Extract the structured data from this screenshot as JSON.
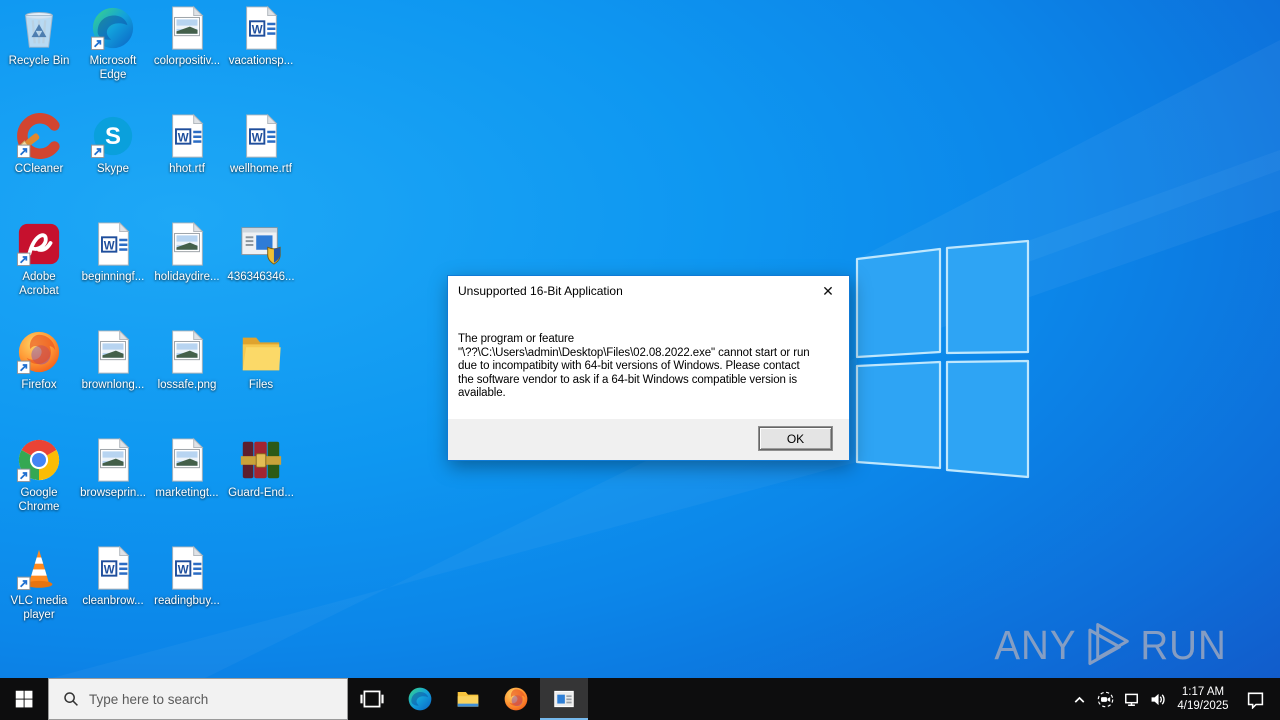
{
  "desktop": {
    "icons": [
      {
        "label": "Recycle Bin",
        "icon": "recycle-bin",
        "shortcut": false
      },
      {
        "label": "Microsoft Edge",
        "icon": "edge",
        "shortcut": true
      },
      {
        "label": "colorpositiv...",
        "icon": "image-file",
        "shortcut": false
      },
      {
        "label": "vacationsp...",
        "icon": "word-file",
        "shortcut": false
      },
      {
        "label": "CCleaner",
        "icon": "ccleaner",
        "shortcut": true
      },
      {
        "label": "Skype",
        "icon": "skype",
        "shortcut": true
      },
      {
        "label": "hhot.rtf",
        "icon": "word-file",
        "shortcut": false
      },
      {
        "label": "wellhome.rtf",
        "icon": "word-file",
        "shortcut": false
      },
      {
        "label": "Adobe Acrobat",
        "icon": "acrobat",
        "shortcut": true
      },
      {
        "label": "beginningf...",
        "icon": "word-file",
        "shortcut": false
      },
      {
        "label": "holidaydire...",
        "icon": "image-file",
        "shortcut": false
      },
      {
        "label": "436346346...",
        "icon": "installer",
        "shortcut": false
      },
      {
        "label": "Firefox",
        "icon": "firefox",
        "shortcut": true
      },
      {
        "label": "brownlong...",
        "icon": "image-file",
        "shortcut": false
      },
      {
        "label": "lossafe.png",
        "icon": "image-file",
        "shortcut": false
      },
      {
        "label": "Files",
        "icon": "folder",
        "shortcut": false
      },
      {
        "label": "Google Chrome",
        "icon": "chrome",
        "shortcut": true
      },
      {
        "label": "browseprin...",
        "icon": "image-file",
        "shortcut": false
      },
      {
        "label": "marketingt...",
        "icon": "image-file",
        "shortcut": false
      },
      {
        "label": "Guard-End...",
        "icon": "winrar",
        "shortcut": false
      },
      {
        "label": "VLC media player",
        "icon": "vlc",
        "shortcut": true
      },
      {
        "label": "cleanbrow...",
        "icon": "word-file",
        "shortcut": false
      },
      {
        "label": "readingbuy...",
        "icon": "word-file",
        "shortcut": false
      }
    ],
    "watermark": {
      "any": "ANY",
      "run": "RUN",
      "logo_icon": "anyrun-play-icon"
    }
  },
  "dialog": {
    "title": "Unsupported 16-Bit Application",
    "close_glyph": "✕",
    "body": "The program or feature\n\"\\??\\C:\\Users\\admin\\Desktop\\Files\\02.08.2022.exe\" cannot start or run\ndue to incompatibity with 64-bit versions of Windows. Please contact\nthe software vendor to ask if a 64-bit Windows compatible version is\navailable.",
    "ok_label": "OK"
  },
  "taskbar": {
    "start_icon": "windows-start-icon",
    "search": {
      "placeholder": "Type here to search",
      "icon": "search-icon"
    },
    "apps": [
      {
        "icon": "task-view",
        "active": false
      },
      {
        "icon": "edge",
        "active": false
      },
      {
        "icon": "file-explorer",
        "active": false
      },
      {
        "icon": "firefox",
        "active": false
      },
      {
        "icon": "window-dialog",
        "active": true
      }
    ],
    "tray": {
      "icons": [
        "chevron-up",
        "meet-now",
        "network",
        "volume"
      ],
      "time": "1:17 AM",
      "date": "4/19/2025",
      "action_center_icon": "action-center-icon"
    }
  },
  "colors": {
    "dialog_border": "#0f7ad6",
    "taskbar_bg": "#0d0d0e",
    "active_underline": "#76b9ed",
    "wallpaper_light": "#1ea8f6",
    "wallpaper_dark": "#1845b6",
    "watermark_text": "#9aa7c0",
    "footer_bg": "#f0f0f0"
  }
}
